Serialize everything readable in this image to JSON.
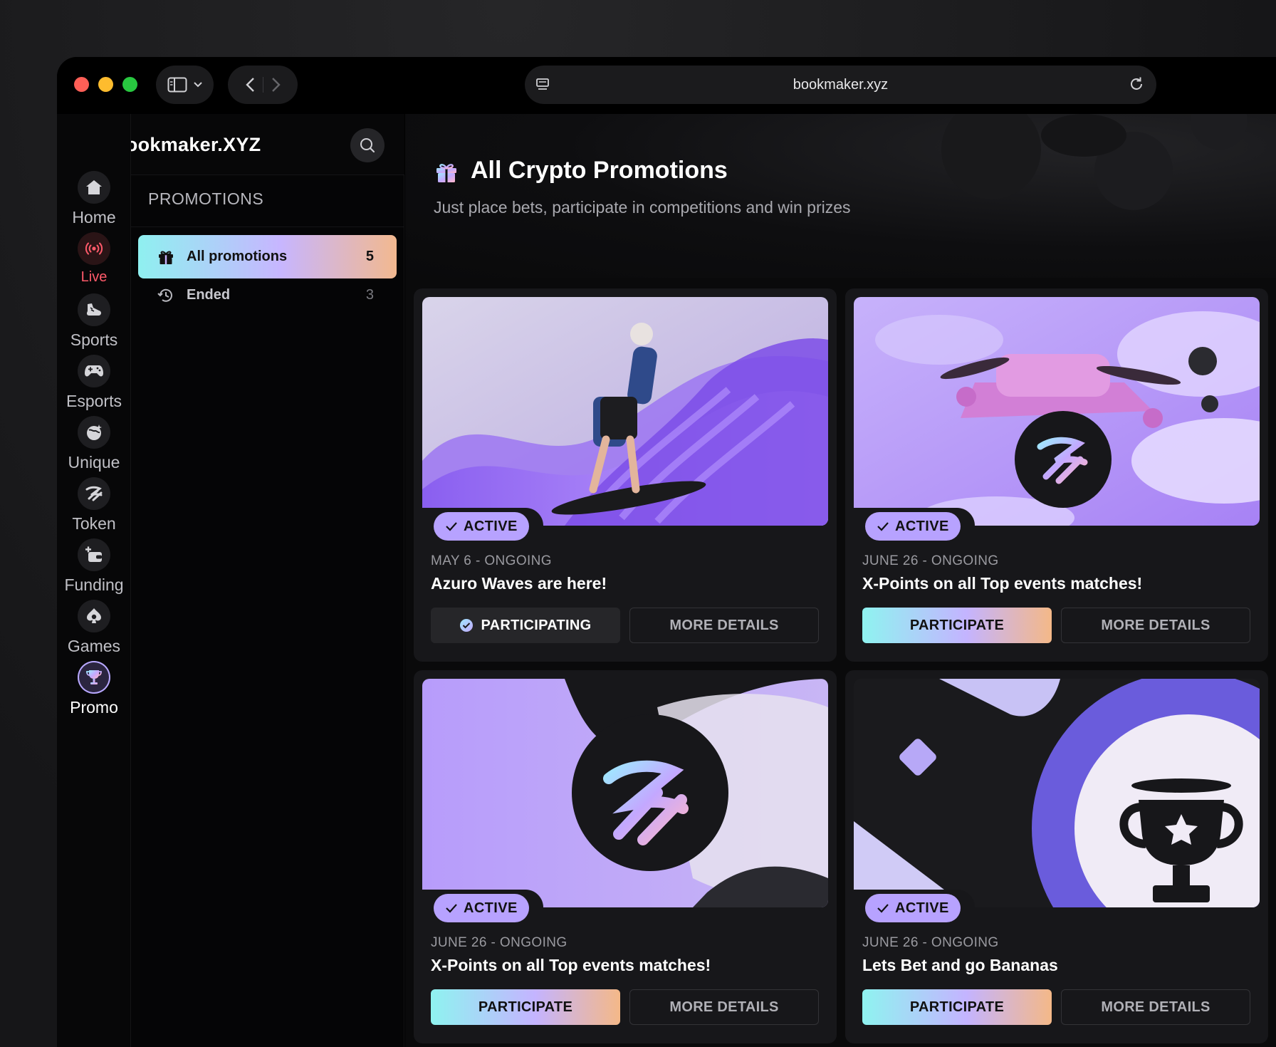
{
  "browser": {
    "url": "bookmaker.xyz"
  },
  "brand": {
    "name": "bookmaker.XYZ"
  },
  "rail": [
    {
      "label": "Home",
      "icon": "home-icon"
    },
    {
      "label": "Live",
      "icon": "live-broadcast-icon"
    },
    {
      "label": "Sports",
      "icon": "sports-shoe-icon"
    },
    {
      "label": "Esports",
      "icon": "gamepad-icon"
    },
    {
      "label": "Unique",
      "icon": "unique-globe-icon"
    },
    {
      "label": "Token",
      "icon": "token-logo-icon"
    },
    {
      "label": "Funding",
      "icon": "wallet-plus-icon"
    },
    {
      "label": "Games",
      "icon": "spade-icon"
    },
    {
      "label": "Promo",
      "icon": "trophy-icon"
    }
  ],
  "subnav": {
    "title": "PROMOTIONS",
    "items": [
      {
        "label": "All promotions",
        "count": "5"
      },
      {
        "label": "Ended",
        "count": "3"
      }
    ]
  },
  "hero": {
    "title": "All Crypto Promotions",
    "subtitle": "Just place bets, participate in competitions and win prizes"
  },
  "cards": [
    {
      "badge": "ACTIVE",
      "date": "MAY 6 - ONGOING",
      "title": "Azuro Waves are here!",
      "primary_label": "PARTICIPATING",
      "secondary_label": "MORE DETAILS"
    },
    {
      "badge": "ACTIVE",
      "date": "JUNE 26 - ONGOING",
      "title": "X-Points on all Top events matches!",
      "primary_label": "PARTICIPATE",
      "secondary_label": "MORE DETAILS"
    },
    {
      "badge": "ACTIVE",
      "date": "JUNE 26 - ONGOING",
      "title": "X-Points on all Top events matches!",
      "primary_label": "PARTICIPATE",
      "secondary_label": "MORE DETAILS"
    },
    {
      "badge": "ACTIVE",
      "date": "JUNE 26 - ONGOING",
      "title": "Lets Bet and go Bananas",
      "primary_label": "PARTICIPATE",
      "secondary_label": "MORE DETAILS"
    }
  ],
  "colors": {
    "accent_purple": "#b7a2ff",
    "gradient_start": "#8ff3f0",
    "gradient_mid": "#c4b4ff",
    "gradient_end": "#f4b888",
    "live_red": "#ff5a6a"
  }
}
